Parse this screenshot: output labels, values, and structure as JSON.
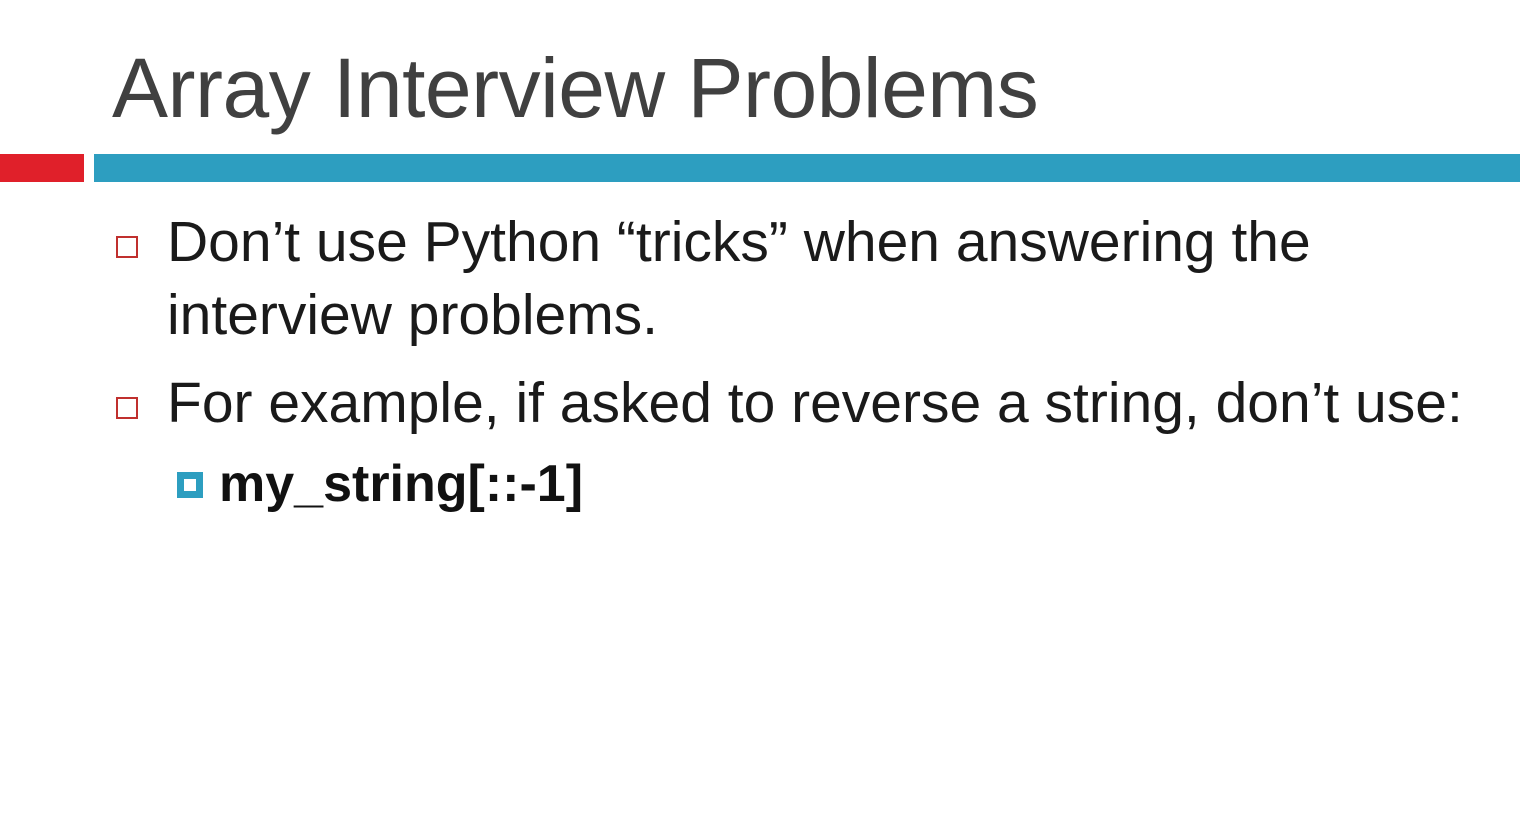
{
  "slide": {
    "title": "Array Interview Problems",
    "accent_colors": {
      "red": "#e0202a",
      "blue": "#2d9ec0"
    },
    "bullets": [
      {
        "text": "Don’t use Python “tricks” when answering the interview problems.",
        "marker_icon": "hollow-square-icon"
      },
      {
        "text": "For example, if asked to reverse a string, don’t use:",
        "marker_icon": "hollow-square-icon",
        "sub_bullets": [
          {
            "text": "my_string[::-1]",
            "marker_icon": "filled-square-icon"
          }
        ]
      }
    ]
  }
}
